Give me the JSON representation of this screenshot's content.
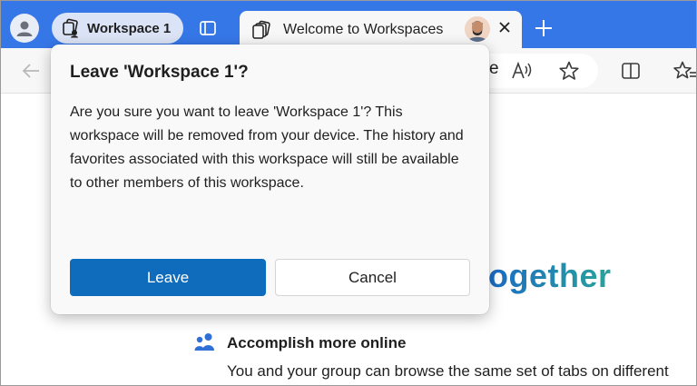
{
  "tabstrip": {
    "workspace_label": "Workspace 1",
    "active_tab_title": "Welcome to Workspaces"
  },
  "toolbar": {
    "address_text_fragment": "e"
  },
  "page": {
    "heading_fragment": "ogether",
    "feature_title": "Accomplish more online",
    "feature_desc": "You and your group can browse the same set of tabs on different"
  },
  "dialog": {
    "title": "Leave 'Workspace 1'?",
    "body": "Are you sure you want to leave 'Workspace 1'? This workspace will be removed from your device. The history and favorites associated with this workspace will still be available to other members of this workspace.",
    "leave_label": "Leave",
    "cancel_label": "Cancel"
  },
  "colors": {
    "tabstrip_bg": "#3677e8",
    "primary_button": "#0f6cbd",
    "dialog_bg": "#f9f9f9"
  },
  "icons": [
    "profile-icon",
    "workspaces-icon",
    "tab-actions-icon",
    "close-icon",
    "plus-icon",
    "back-arrow-icon",
    "read-aloud-icon",
    "star-icon",
    "split-screen-icon",
    "favorites-icon",
    "people-icon"
  ]
}
